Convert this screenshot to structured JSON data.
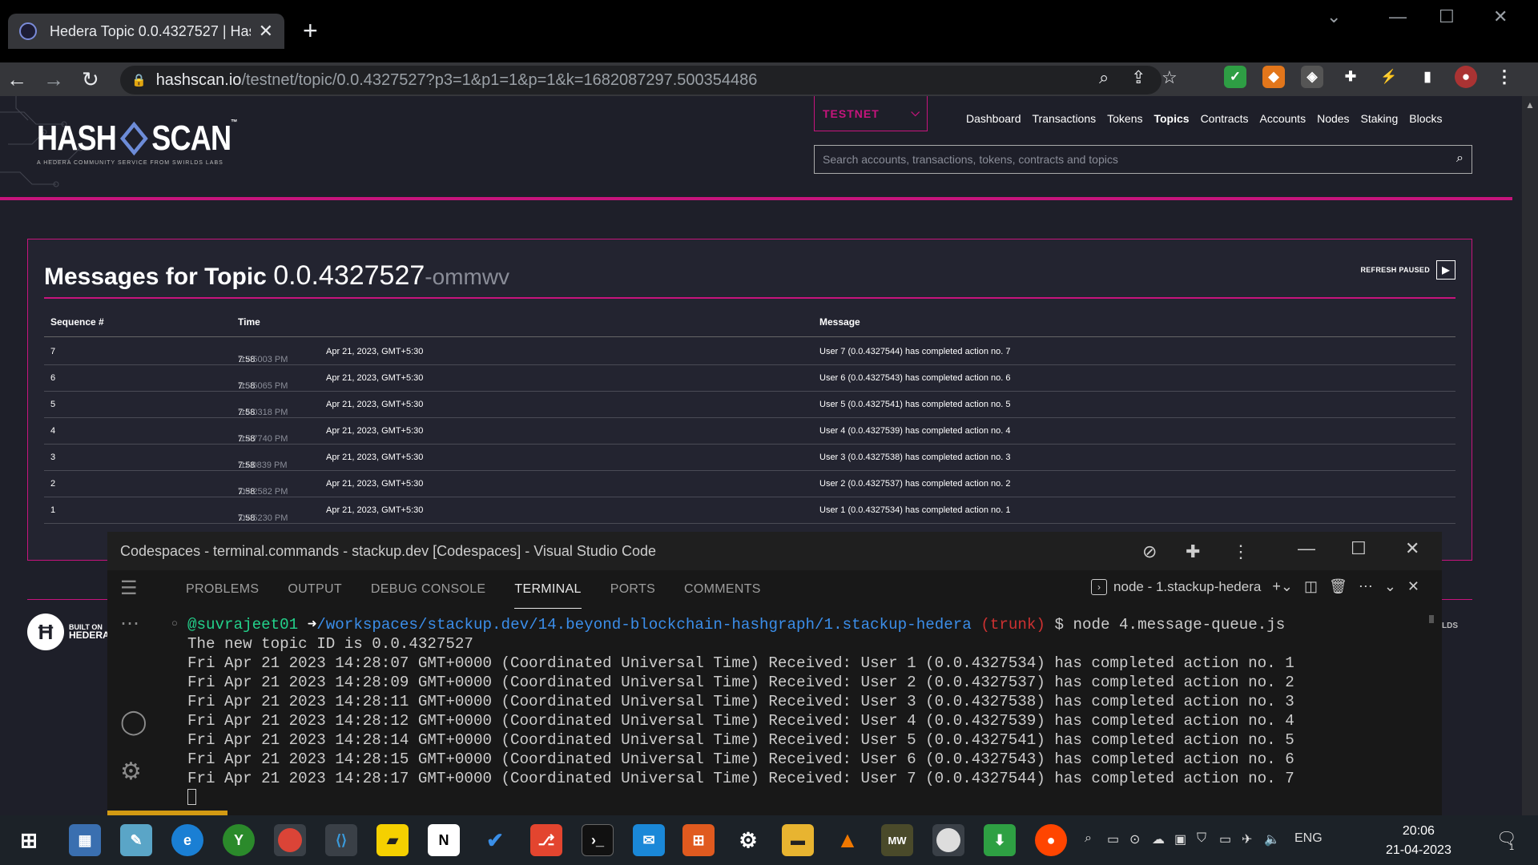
{
  "browser": {
    "tab_title": "Hedera Topic 0.0.4327527 | HashS",
    "url_domain": "hashscan.io",
    "url_path": "/testnet/topic/0.0.4327527?p3=1&p1=1&p=1&k=1682087297.500354486"
  },
  "hashscan": {
    "logo_text_a": "HASH",
    "logo_text_b": "SCAN",
    "logo_tm": "™",
    "logo_sub": "A HEDERA COMMUNITY SERVICE FROM SWIRLDS LABS",
    "network": "TESTNET",
    "nav": [
      "Dashboard",
      "Transactions",
      "Tokens",
      "Topics",
      "Contracts",
      "Accounts",
      "Nodes",
      "Staking",
      "Blocks"
    ],
    "active_nav": "Topics",
    "search_placeholder": "Search accounts, transactions, tokens, contracts and topics",
    "title_prefix": "Messages for Topic",
    "topic_id": "0.0.4327527",
    "topic_alias": "-ommwv",
    "refresh_label": "REFRESH PAUSED",
    "columns": [
      "Sequence #",
      "Time",
      "Message"
    ],
    "rows": [
      {
        "seq": "7",
        "time_main": "7:58",
        "time_frac": ":17.5003 PM",
        "date": "Apr 21, 2023, GMT+5:30",
        "message": "User 7 (0.0.4327544) has completed action no. 7"
      },
      {
        "seq": "6",
        "time_main": "7:58",
        "time_frac": ":15.5065 PM",
        "date": "Apr 21, 2023, GMT+5:30",
        "message": "User 6 (0.0.4327543) has completed action no. 6"
      },
      {
        "seq": "5",
        "time_main": "7:58",
        "time_frac": ":14.0318 PM",
        "date": "Apr 21, 2023, GMT+5:30",
        "message": "User 5 (0.0.4327541) has completed action no. 5"
      },
      {
        "seq": "4",
        "time_main": "7:58",
        "time_frac": ":12.7740 PM",
        "date": "Apr 21, 2023, GMT+5:30",
        "message": "User 4 (0.0.4327539) has completed action no. 4"
      },
      {
        "seq": "3",
        "time_main": "7:58",
        "time_frac": ":11.0839 PM",
        "date": "Apr 21, 2023, GMT+5:30",
        "message": "User 3 (0.0.4327538) has completed action no. 3"
      },
      {
        "seq": "2",
        "time_main": "7:58",
        "time_frac": ":09.2582 PM",
        "date": "Apr 21, 2023, GMT+5:30",
        "message": "User 2 (0.0.4327537) has completed action no. 2"
      },
      {
        "seq": "1",
        "time_main": "7:58",
        "time_frac": ":07.5230 PM",
        "date": "Apr 21, 2023, GMT+5:30",
        "message": "User 1 (0.0.4327534) has completed action no. 1"
      }
    ],
    "footer_built_on": "BUILT ON",
    "footer_hedera": "HEDERA",
    "footer_swirlds_a": "IRLDS",
    "footer_swirlds_b": "S"
  },
  "vscode": {
    "title": "Codespaces - terminal.commands - stackup.dev [Codespaces] - Visual Studio Code",
    "panel_tabs": [
      "PROBLEMS",
      "OUTPUT",
      "DEBUG CONSOLE",
      "TERMINAL",
      "PORTS",
      "COMMENTS"
    ],
    "active_tab": "TERMINAL",
    "terminal_name": "node - 1.stackup-hedera",
    "prompt_user": "@suvrajeet01",
    "prompt_arrow": "➜",
    "prompt_path": "/workspaces/stackup.dev/14.beyond-blockchain-hashgraph/1.stackup-hedera",
    "prompt_branch_open": "(",
    "prompt_branch": "trunk",
    "prompt_branch_close": ")",
    "prompt_cmd": "$ node 4.message-queue.js",
    "output_lines": [
      "The new topic ID is 0.0.4327527",
      "Fri Apr 21 2023 14:28:07 GMT+0000 (Coordinated Universal Time) Received: User 1 (0.0.4327534) has completed action no. 1",
      "Fri Apr 21 2023 14:28:09 GMT+0000 (Coordinated Universal Time) Received: User 2 (0.0.4327537) has completed action no. 2",
      "Fri Apr 21 2023 14:28:11 GMT+0000 (Coordinated Universal Time) Received: User 3 (0.0.4327538) has completed action no. 3",
      "Fri Apr 21 2023 14:28:12 GMT+0000 (Coordinated Universal Time) Received: User 4 (0.0.4327539) has completed action no. 4",
      "Fri Apr 21 2023 14:28:14 GMT+0000 (Coordinated Universal Time) Received: User 5 (0.0.4327541) has completed action no. 5",
      "Fri Apr 21 2023 14:28:15 GMT+0000 (Coordinated Universal Time) Received: User 6 (0.0.4327543) has completed action no. 6",
      "Fri Apr 21 2023 14:28:17 GMT+0000 (Coordinated Universal Time) Received: User 7 (0.0.4327544) has completed action no. 7"
    ]
  },
  "taskbar": {
    "language": "ENG",
    "time": "20:06",
    "date": "21-04-2023",
    "notification_count": "1",
    "apps": [
      "start",
      "calculator",
      "notepad",
      "edge",
      "xbox",
      "chrome",
      "vscode",
      "sticky-notes",
      "notion",
      "todo",
      "git",
      "terminal",
      "outlook",
      "store",
      "settings",
      "file-explorer",
      "vlc",
      "mw",
      "github-desktop",
      "download",
      "reddit"
    ]
  },
  "colors": {
    "accent_magenta": "#c7147d",
    "page_bg": "#1e1f29",
    "term_path": "#3b8eea",
    "term_user": "#23d18b",
    "term_branch": "#e5e510"
  }
}
